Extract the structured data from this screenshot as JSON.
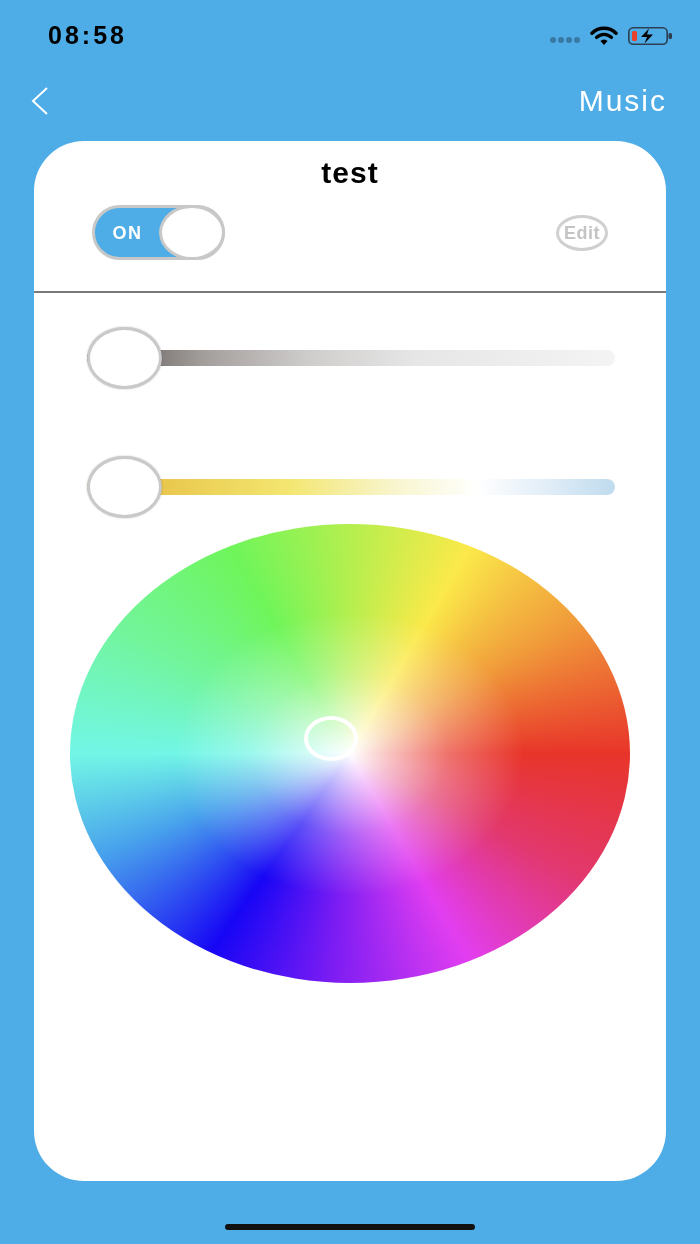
{
  "status_bar": {
    "time": "08:58"
  },
  "nav": {
    "action": "Music"
  },
  "card": {
    "title": "test",
    "power": {
      "label": "ON",
      "on": true
    },
    "edit_button": {
      "label": "Edit"
    },
    "sliders": [
      {
        "kind": "brightness",
        "level": 0
      },
      {
        "kind": "temperature",
        "level": 0
      }
    ]
  }
}
